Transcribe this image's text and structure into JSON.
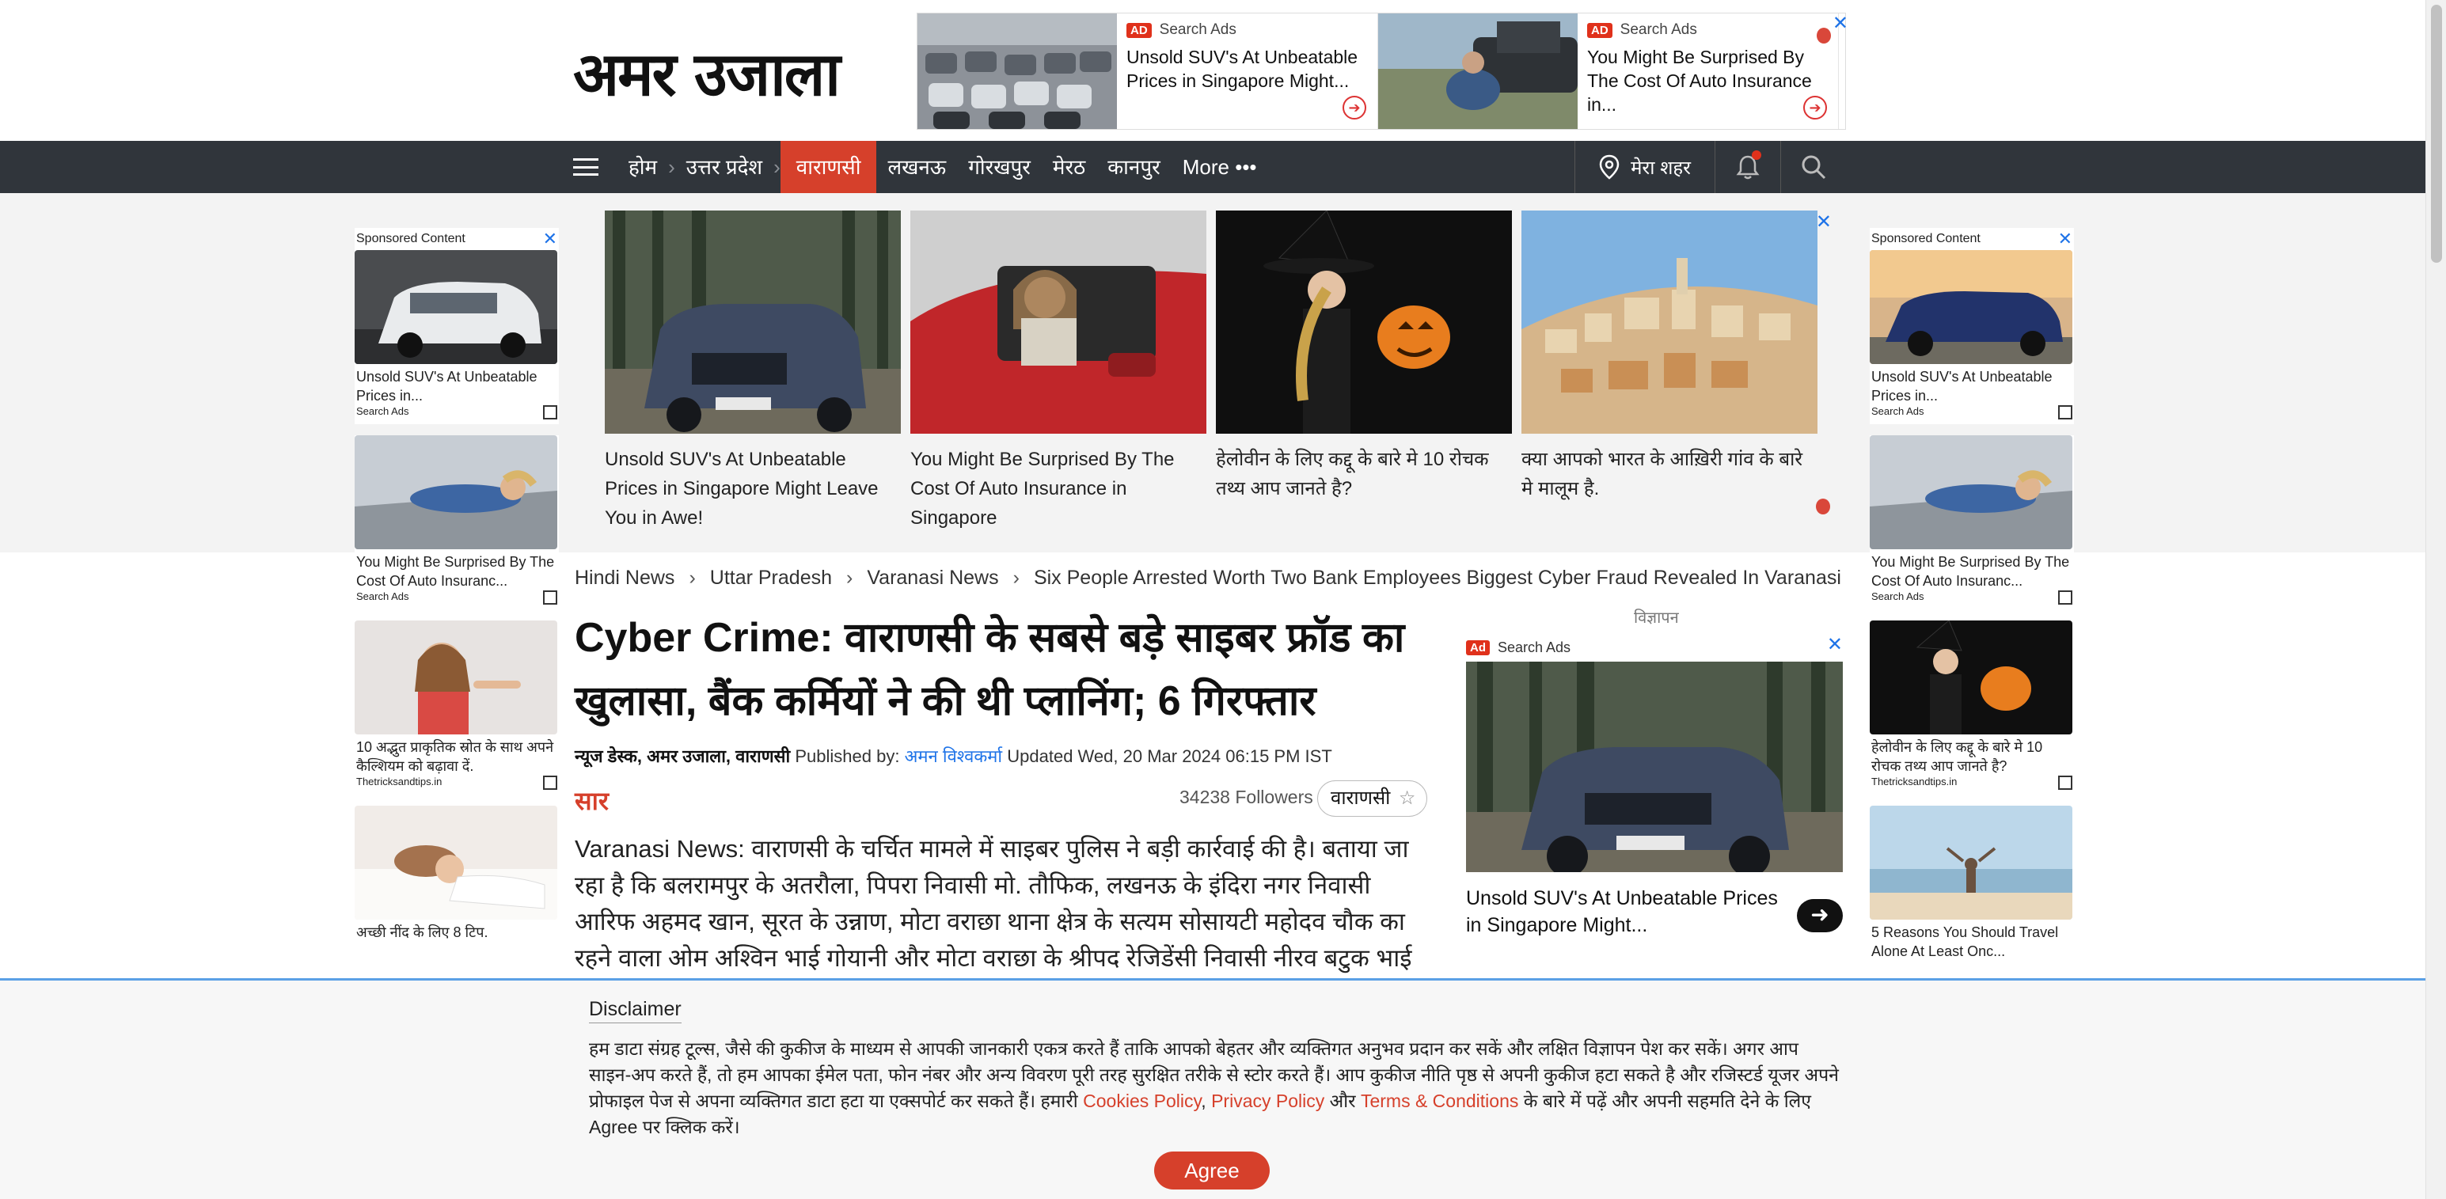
{
  "header": {
    "logo": "अमर उजाला",
    "top_ads": [
      {
        "badge": "AD",
        "source": "Search Ads",
        "title": "Unsold SUV's At Unbeatable Prices in Singapore Might..."
      },
      {
        "badge": "AD",
        "source": "Search Ads",
        "title": "You Might Be Surprised By The Cost Of Auto Insurance in..."
      }
    ],
    "close": "✕"
  },
  "nav": {
    "items": [
      "होम",
      "उत्तर प्रदेश",
      "वाराणसी",
      "लखनऊ",
      "गोरखपुर",
      "मेरठ",
      "कानपुर",
      "More •••"
    ],
    "city": "मेरा शहर"
  },
  "sponsored_strip": [
    {
      "title": "Unsold SUV's At Unbeatable Prices in Singapore Might Leave You in Awe!"
    },
    {
      "title": "You Might Be Surprised By The Cost Of Auto Insurance in Singapore"
    },
    {
      "title": "हेलोवीन के लिए कद्दू के बारे मे 10 रोचक तथ्य आप जानते है?"
    },
    {
      "title": "क्या आपको भारत के आख़िरी गांव के बारे मे मालूम है."
    }
  ],
  "left_sidebar": {
    "header": "Sponsored Content",
    "cards": [
      {
        "title": "Unsold SUV's At Unbeatable Prices in...",
        "source": "Search Ads"
      },
      {
        "title": "You Might Be Surprised By The Cost Of Auto Insuranc...",
        "source": "Search Ads"
      },
      {
        "title": "10 अद्भुत प्राकृतिक स्रोत के साथ अपने कैल्शियम को बढ़ावा दें.",
        "source": "Thetricksandtips.in"
      },
      {
        "title": "अच्छी नींद के लिए 8 टिप.",
        "source": ""
      }
    ]
  },
  "right_sidebar": {
    "header": "Sponsored Content",
    "cards": [
      {
        "title": "Unsold SUV's At Unbeatable Prices in...",
        "source": "Search Ads"
      },
      {
        "title": "You Might Be Surprised By The Cost Of Auto Insuranc...",
        "source": "Search Ads"
      },
      {
        "title": "हेलोवीन के लिए कद्दू के बारे मे 10 रोचक तथ्य आप जानते है?",
        "source": "Thetricksandtips.in"
      },
      {
        "title": "5 Reasons You Should Travel Alone At Least Onc...",
        "source": ""
      }
    ]
  },
  "breadcrumb": [
    "Hindi News",
    "Uttar Pradesh",
    "Varanasi News",
    "Six People Arrested Worth Two Bank Employees Biggest Cyber Fraud Revealed In Varanasi"
  ],
  "breadcrumb_sep": "›",
  "article": {
    "headline": "Cyber Crime: वाराणसी के सबसे बड़े साइबर फ्रॉड का खुलासा, बैंक कर्मियों ने की थी प्लानिंग; 6 गिरफ्तार",
    "desk": "न्यूज डेस्क, अमर उजाला, वाराणसी",
    "published_by_label": "Published by:",
    "author": "अमन विश्वकर्मा",
    "updated": "Updated Wed, 20 Mar 2024 06:15 PM IST",
    "saar": "सार",
    "followers": "34238 Followers",
    "follow_tag": "वाराणसी",
    "body": "Varanasi News: वाराणसी के चर्चित मामले में साइबर पुलिस ने बड़ी कार्रवाई की है। बताया जा रहा है कि बलरामपुर के अतरौला, पिपरा निवासी मो. तौफिक, लखनऊ के इंदिरा नगर निवासी आरिफ अहमद खान, सूरत के उन्नाण, मोटा वराछा थाना क्षेत्र के सत्यम सोसायटी महोदव चौक का रहने वाला ओम अश्विन भाई गोयानी और मोटा वराछा के श्रीपद रेजिडेंसी निवासी नीरव बटुक भाई"
  },
  "right_ad": {
    "label": "विज्ञापन",
    "badge": "Ad",
    "source": "Search Ads",
    "title": "Unsold SUV's At Unbeatable Prices in Singapore Might..."
  },
  "disclaimer": {
    "title": "Disclaimer",
    "text_1": "हम डाटा संग्रह टूल्स, जैसे की कुकीज के माध्यम से आपकी जानकारी एकत्र करते हैं ताकि आपको बेहतर और व्यक्तिगत अनुभव प्रदान कर सकें और लक्षित विज्ञापन पेश कर सकें। अगर आप साइन-अप करते हैं, तो हम आपका ईमेल पता, फोन नंबर और अन्य विवरण पूरी तरह सुरक्षित तरीके से स्टोर करते हैं। आप कुकीज नीति पृष्ठ से अपनी कुकीज हटा सकते है और रजिस्टर्ड यूजर अपने प्रोफाइल पेज से अपना व्यक्तिगत डाटा हटा या एक्सपोर्ट कर सकते हैं। हमारी",
    "link_cookies": "Cookies Policy",
    "comma": ",",
    "link_privacy": "Privacy Policy",
    "and": "और",
    "link_terms": "Terms & Conditions",
    "text_2": "के बारे में पढ़ें और अपनी सहमति देने के लिए Agree पर क्लिक करें।",
    "agree": "Agree"
  },
  "colors": {
    "accent": "#d6402b",
    "nav_bg": "#30353b",
    "link": "#1e73e8"
  }
}
